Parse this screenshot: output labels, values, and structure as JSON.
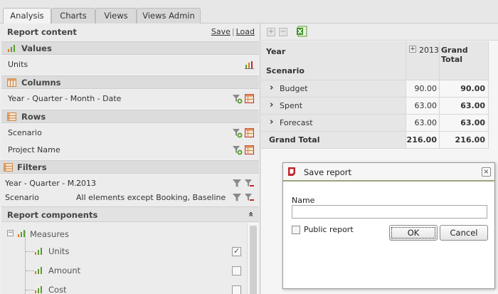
{
  "tabs": [
    {
      "label": "Analysis",
      "active": true
    },
    {
      "label": "Charts",
      "active": false
    },
    {
      "label": "Views",
      "active": false
    },
    {
      "label": "Views Admin",
      "active": false
    }
  ],
  "left_panel": {
    "title": "Report content",
    "save_label": "Save",
    "separator": "|",
    "load_label": "Load",
    "values": {
      "title": "Values",
      "items": [
        {
          "label": "Units"
        }
      ]
    },
    "columns": {
      "title": "Columns",
      "items": [
        {
          "label": "Year - Quarter - Month - Date"
        }
      ]
    },
    "rows": {
      "title": "Rows",
      "items": [
        {
          "label": "Scenario"
        },
        {
          "label": "Project Name"
        }
      ]
    },
    "filters": {
      "title": "Filters",
      "items": [
        {
          "label": "Year - Quarter - M...",
          "value": "2013"
        },
        {
          "label": "Scenario",
          "value": "All elements except Booking, Baseline"
        }
      ]
    },
    "components": {
      "title": "Report components",
      "collapse_glyph": "«",
      "measures_label": "Measures",
      "items": [
        {
          "label": "Units",
          "checked": true
        },
        {
          "label": "Amount",
          "checked": false
        },
        {
          "label": "Cost",
          "checked": false
        }
      ]
    }
  },
  "right_panel": {
    "toolbar": {
      "expand": "+",
      "collapse": "−"
    },
    "grid": {
      "corner_label": "Year",
      "scenario_label": "Scenario",
      "col_expand_glyph": "+",
      "col_headers": [
        "2013",
        "Grand Total"
      ],
      "rows": [
        {
          "label": "Budget",
          "values": [
            "90.00",
            "90.00"
          ]
        },
        {
          "label": "Spent",
          "values": [
            "63.00",
            "63.00"
          ]
        },
        {
          "label": "Forecast",
          "values": [
            "63.00",
            "63.00"
          ]
        }
      ],
      "total": {
        "label": "Grand Total",
        "values": [
          "216.00",
          "216.00"
        ]
      },
      "row_expand_glyph": "›"
    }
  },
  "dialog": {
    "title": "Save report",
    "close_glyph": "×",
    "name_label": "Name",
    "name_value": "",
    "public_label": "Public report",
    "public_checked": false,
    "ok_label": "OK",
    "cancel_label": "Cancel"
  },
  "colors": {
    "dialog_accent": "#9aa67e",
    "logo_red": "#c0282d",
    "bars_orange": "#e07a1f",
    "bars_green": "#5a9e2f"
  }
}
